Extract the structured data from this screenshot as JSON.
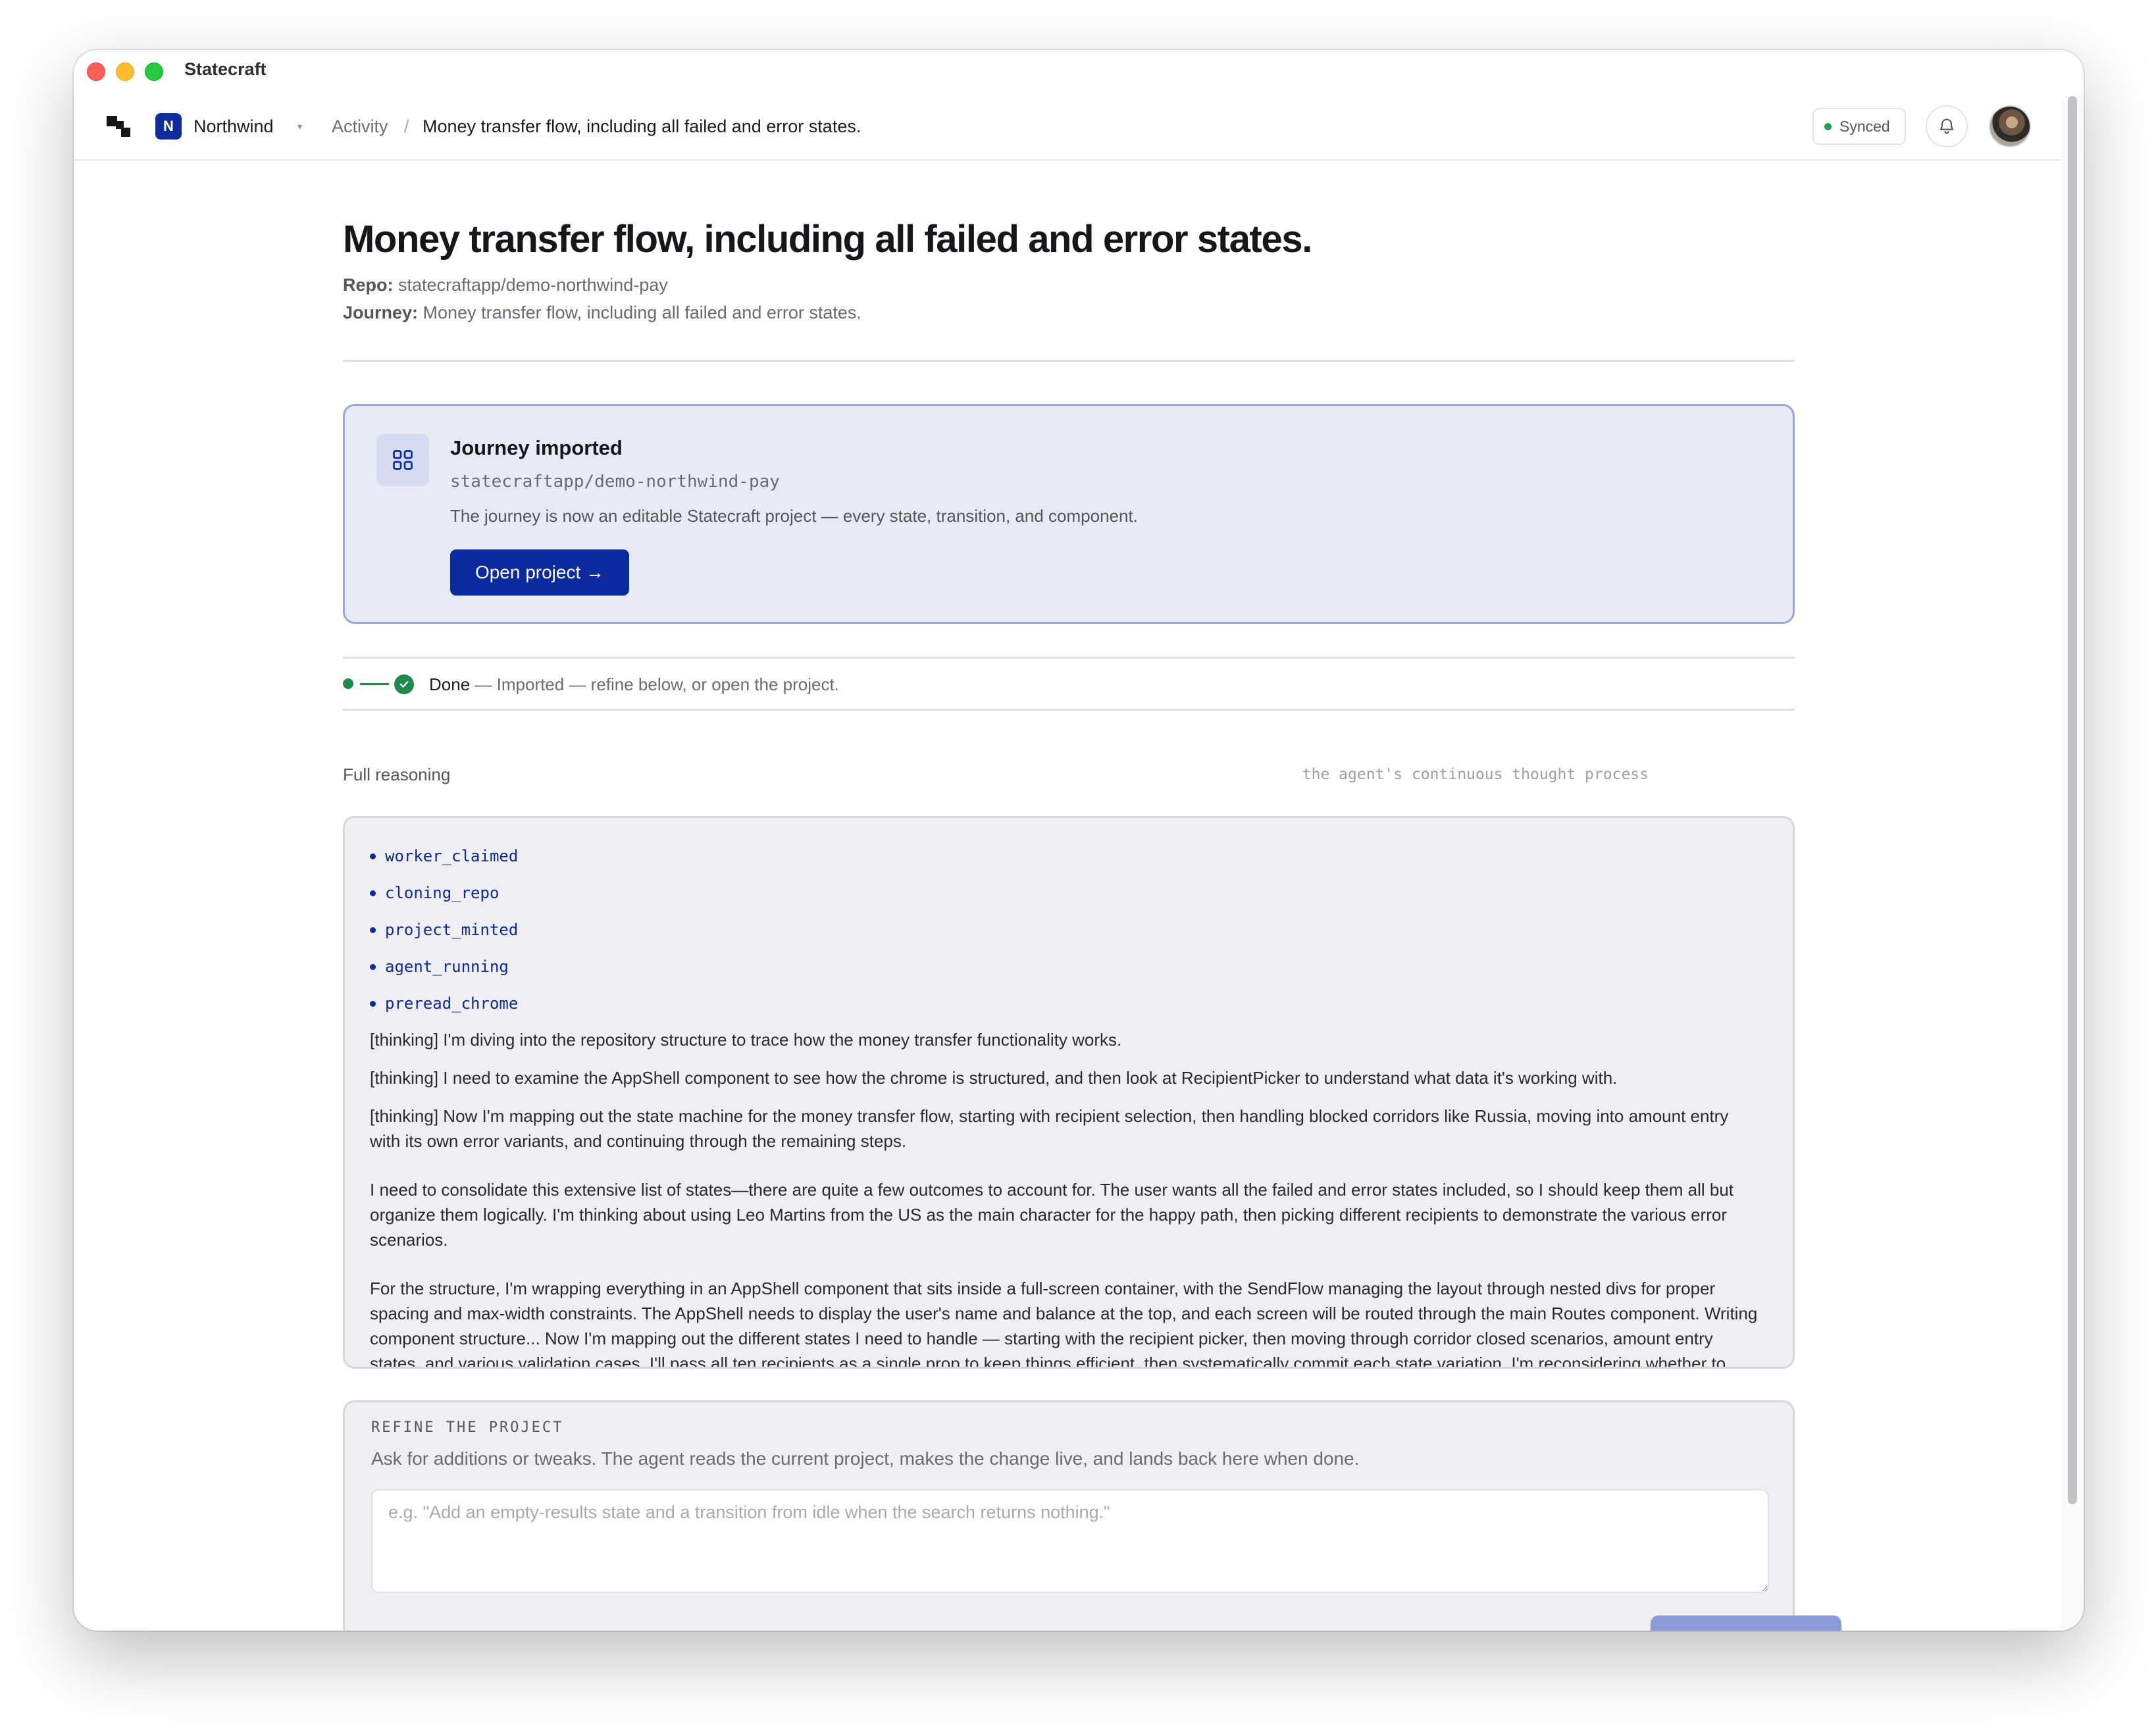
{
  "window": {
    "app_title": "Statecraft"
  },
  "nav": {
    "org_initial": "N",
    "org_name": "Northwind",
    "org_caret": "▾",
    "crumb_activity": "Activity",
    "crumb_sep": "/",
    "crumb_current": "Money transfer flow, including all failed and error states.",
    "synced_label": "Synced",
    "colors": {
      "brand": "#0f2d9c",
      "synced": "#1f9d55"
    }
  },
  "header": {
    "title": "Money transfer flow, including all failed and error states.",
    "repo_label": "Repo:",
    "repo_value": "statecraftapp/demo-northwind-pay",
    "journey_label": "Journey:",
    "journey_value": "Money transfer flow, including all failed and error states."
  },
  "import_card": {
    "icon": "grid-icon",
    "title": "Journey imported",
    "repo": "statecraftapp/demo-northwind-pay",
    "description": "The journey is now an editable Statecraft project — every state, transition, and component.",
    "button_label": "Open project →"
  },
  "status": {
    "state": "Done",
    "detail": " — Imported — refine below, or open the project.",
    "color": "#1f8a4c"
  },
  "reasoning": {
    "label": "Full reasoning",
    "hint": "the agent's continuous thought process",
    "events": [
      "worker_claimed",
      "cloning_repo",
      "project_minted",
      "agent_running",
      "preread_chrome"
    ],
    "thoughts": [
      "[thinking] I'm diving into the repository structure to trace how the money transfer functionality works.",
      "[thinking] I need to examine the AppShell component to see how the chrome is structured, and then look at RecipientPicker to understand what data it's working with.",
      "[thinking] Now I'm mapping out the state machine for the money transfer flow, starting with recipient selection, then handling blocked corridors like Russia, moving into amount entry with its own error variants, and continuing through the remaining steps."
    ],
    "paragraphs": [
      "I need to consolidate this extensive list of states—there are quite a few outcomes to account for. The user wants all the failed and error states included, so I should keep them all but organize them logically. I'm thinking about using Leo Martins from the US as the main character for the happy path, then picking different recipients to demonstrate the various error scenarios.",
      "For the structure, I'm wrapping everything in an AppShell component that sits inside a full-screen container, with the SendFlow managing the layout through nested divs for proper spacing and max-width constraints. The AppShell needs to display the user's name and balance at the top, and each screen will be routed through the main Routes component. Writing component structure... Now I'm mapping out the different states I need to handle — starting with the recipient picker, then moving through corridor closed scenarios, amount entry states, and various validation cases. I'll pass all ten recipients as a single prop to keep things efficient, then systematically commit each state variation. I'm reconsidering whether to"
    ]
  },
  "refine": {
    "label": "REFINE THE PROJECT",
    "description": "Ask for additions or tweaks. The agent reads the current project, makes the change live, and lands back here when done.",
    "placeholder": "e.g. \"Add an empty-results state and a transition from idle when the search returns nothing.\""
  }
}
